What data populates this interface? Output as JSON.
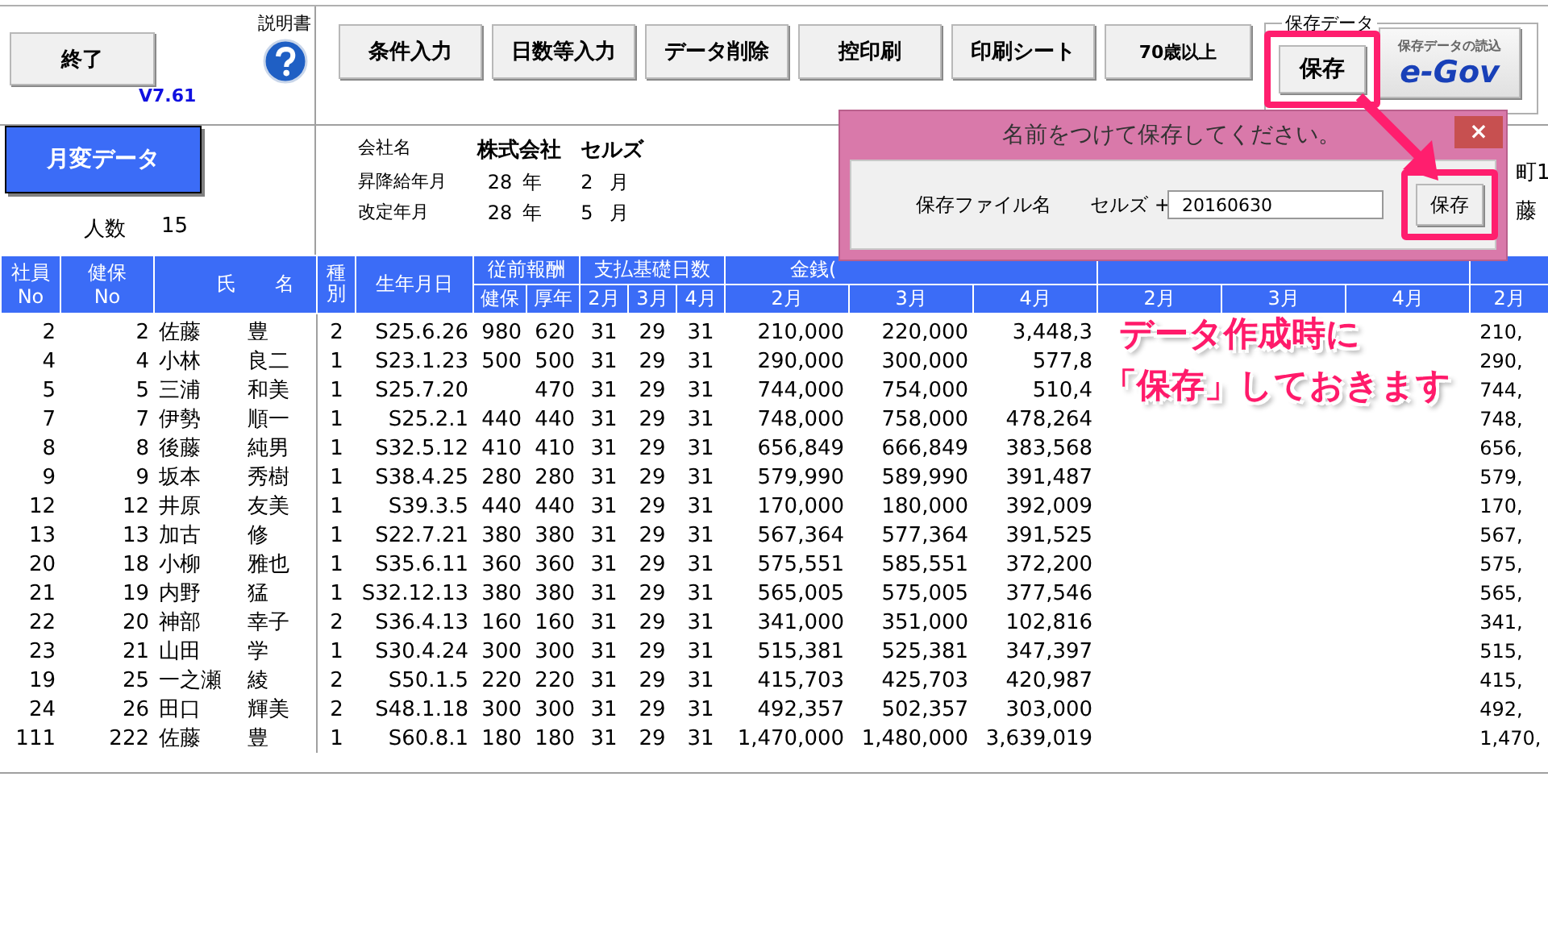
{
  "left_panel": {
    "exit_button": "終了",
    "manual_label": "説明書",
    "version": "V7.61",
    "mode_button": "月変データ",
    "headcount_label": "人数",
    "headcount": "15"
  },
  "toolbar": [
    "条件入力",
    "日数等入力",
    "データ削除",
    "控印刷",
    "印刷シート",
    "70歳以上"
  ],
  "save_group": {
    "title": "保存データ",
    "save_button": {
      "label": "保存",
      "highlighted": true
    },
    "egov_button": {
      "caption": "保存データの読込",
      "logo": "e-Gov"
    }
  },
  "company": {
    "name_label": "会社名",
    "name": [
      "株式会社",
      "セルズ"
    ],
    "dates": [
      {
        "label": "昇降給年月",
        "year": "28",
        "year_unit": "年",
        "month": "2",
        "month_unit": "月"
      },
      {
        "label": "改定年月",
        "year": "28",
        "year_unit": "年",
        "month": "5",
        "month_unit": "月"
      }
    ],
    "cut_texts": [
      "町1",
      "藤"
    ]
  },
  "dialog": {
    "title": "名前をつけて保存してください。",
    "close": "×",
    "field_label": "保存ファイル名",
    "prefix": "セルズ +",
    "value": "20160630",
    "save_button": {
      "label": "保存",
      "highlighted": true
    }
  },
  "annotation": {
    "lines": [
      "データ作成時に",
      "「保存」しておきます"
    ]
  },
  "table": {
    "header_top": [
      {
        "label": "社員\nNo",
        "kind": "single"
      },
      {
        "label": "健保\nNo",
        "kind": "single"
      },
      {
        "label": "氏",
        "kind": "surname"
      },
      {
        "label": "名",
        "kind": "given"
      },
      {
        "label": "種別",
        "kind": "narrow"
      },
      {
        "label": "生年月日",
        "kind": "single"
      },
      {
        "label": "従前報酬",
        "kind": "group",
        "subs": [
          "健保",
          "厚年"
        ]
      },
      {
        "label": "支払基礎日数",
        "kind": "group",
        "subs": [
          "2月",
          "3月",
          "4月"
        ]
      },
      {
        "label": "金銭(",
        "kind": "cut",
        "subs": [
          "2月",
          "3月",
          "4月"
        ]
      },
      {
        "kind": "group",
        "subs": [
          "2月",
          "3月",
          "4月"
        ]
      },
      {
        "kind": "group",
        "subs": [
          "2月"
        ]
      }
    ],
    "rows": [
      {
        "emp_no": "2",
        "kenpo_no": "2",
        "surname": "佐藤",
        "given": "豊",
        "type": "2",
        "birth": "S25.6.26",
        "prev_kenpo": "980",
        "prev_kosei": "620",
        "days": [
          "31",
          "29",
          "31"
        ],
        "cash": [
          "210,000",
          "220,000",
          "3,448,3"
        ],
        "last": "210,"
      },
      {
        "emp_no": "4",
        "kenpo_no": "4",
        "surname": "小林",
        "given": "良二",
        "type": "1",
        "birth": "S23.1.23",
        "prev_kenpo": "500",
        "prev_kosei": "500",
        "days": [
          "31",
          "29",
          "31"
        ],
        "cash": [
          "290,000",
          "300,000",
          "577,8"
        ],
        "last": "290,"
      },
      {
        "emp_no": "5",
        "kenpo_no": "5",
        "surname": "三浦",
        "given": "和美",
        "type": "1",
        "birth": "S25.7.20",
        "prev_kosei": "470",
        "days": [
          "31",
          "29",
          "31"
        ],
        "cash": [
          "744,000",
          "754,000",
          "510,4"
        ],
        "last": "744,"
      },
      {
        "emp_no": "7",
        "kenpo_no": "7",
        "surname": "伊勢",
        "given": "順一",
        "type": "1",
        "birth": "S25.2.1",
        "prev_kenpo": "440",
        "prev_kosei": "440",
        "days": [
          "31",
          "29",
          "31"
        ],
        "cash": [
          "748,000",
          "758,000",
          "478,264"
        ],
        "last": "748,"
      },
      {
        "emp_no": "8",
        "kenpo_no": "8",
        "surname": "後藤",
        "given": "純男",
        "type": "1",
        "birth": "S32.5.12",
        "prev_kenpo": "410",
        "prev_kosei": "410",
        "days": [
          "31",
          "29",
          "31"
        ],
        "cash": [
          "656,849",
          "666,849",
          "383,568"
        ],
        "last": "656,"
      },
      {
        "emp_no": "9",
        "kenpo_no": "9",
        "surname": "坂本",
        "given": "秀樹",
        "type": "1",
        "birth": "S38.4.25",
        "prev_kenpo": "280",
        "prev_kosei": "280",
        "days": [
          "31",
          "29",
          "31"
        ],
        "cash": [
          "579,990",
          "589,990",
          "391,487"
        ],
        "last": "579,"
      },
      {
        "emp_no": "12",
        "kenpo_no": "12",
        "surname": "井原",
        "given": "友美",
        "type": "1",
        "birth": "S39.3.5",
        "prev_kenpo": "440",
        "prev_kosei": "440",
        "days": [
          "31",
          "29",
          "31"
        ],
        "cash": [
          "170,000",
          "180,000",
          "392,009"
        ],
        "last": "170,"
      },
      {
        "emp_no": "13",
        "kenpo_no": "13",
        "surname": "加古",
        "given": "修",
        "type": "1",
        "birth": "S22.7.21",
        "prev_kenpo": "380",
        "prev_kosei": "380",
        "days": [
          "31",
          "29",
          "31"
        ],
        "cash": [
          "567,364",
          "577,364",
          "391,525"
        ],
        "last": "567,"
      },
      {
        "emp_no": "20",
        "kenpo_no": "18",
        "surname": "小柳",
        "given": "雅也",
        "type": "1",
        "birth": "S35.6.11",
        "prev_kenpo": "360",
        "prev_kosei": "360",
        "days": [
          "31",
          "29",
          "31"
        ],
        "cash": [
          "575,551",
          "585,551",
          "372,200"
        ],
        "last": "575,"
      },
      {
        "emp_no": "21",
        "kenpo_no": "19",
        "surname": "内野",
        "given": "猛",
        "type": "1",
        "birth": "S32.12.13",
        "prev_kenpo": "380",
        "prev_kosei": "380",
        "days": [
          "31",
          "29",
          "31"
        ],
        "cash": [
          "565,005",
          "575,005",
          "377,546"
        ],
        "last": "565,"
      },
      {
        "emp_no": "22",
        "kenpo_no": "20",
        "surname": "神部",
        "given": "幸子",
        "type": "2",
        "birth": "S36.4.13",
        "prev_kenpo": "160",
        "prev_kosei": "160",
        "days": [
          "31",
          "29",
          "31"
        ],
        "cash": [
          "341,000",
          "351,000",
          "102,816"
        ],
        "last": "341,"
      },
      {
        "emp_no": "23",
        "kenpo_no": "21",
        "surname": "山田",
        "given": "学",
        "type": "1",
        "birth": "S30.4.24",
        "prev_kenpo": "300",
        "prev_kosei": "300",
        "days": [
          "31",
          "29",
          "31"
        ],
        "cash": [
          "515,381",
          "525,381",
          "347,397"
        ],
        "last": "515,"
      },
      {
        "emp_no": "19",
        "kenpo_no": "25",
        "surname": "一之瀬",
        "given": "綾",
        "type": "2",
        "birth": "S50.1.5",
        "prev_kenpo": "220",
        "prev_kosei": "220",
        "days": [
          "31",
          "29",
          "31"
        ],
        "cash": [
          "415,703",
          "425,703",
          "420,987"
        ],
        "last": "415,"
      },
      {
        "emp_no": "24",
        "kenpo_no": "26",
        "surname": "田口",
        "given": "輝美",
        "type": "2",
        "birth": "S48.1.18",
        "prev_kenpo": "300",
        "prev_kosei": "300",
        "days": [
          "31",
          "29",
          "31"
        ],
        "cash": [
          "492,357",
          "502,357",
          "303,000"
        ],
        "last": "492,"
      },
      {
        "emp_no": "111",
        "kenpo_no": "222",
        "surname": "佐藤",
        "given": "豊",
        "type": "1",
        "birth": "S60.8.1",
        "prev_kenpo": "180",
        "prev_kosei": "180",
        "days": [
          "31",
          "29",
          "31"
        ],
        "cash": [
          "1,470,000",
          "1,480,000",
          "3,639,019"
        ],
        "last": "1,470,"
      }
    ]
  }
}
